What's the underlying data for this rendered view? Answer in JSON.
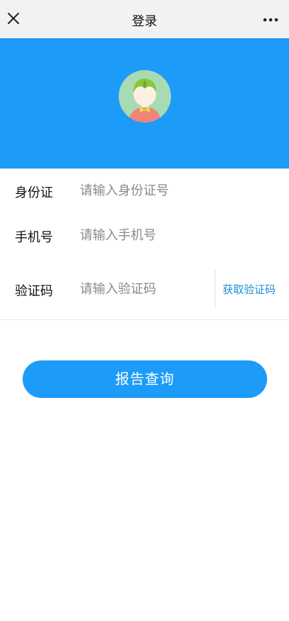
{
  "navbar": {
    "title": "登录",
    "close_icon": "close-icon",
    "more_icon": "more-horizontal-icon"
  },
  "banner": {
    "avatar_icon": "user-avatar-icon",
    "color": "#1c9bf8"
  },
  "form": {
    "id_card": {
      "label": "身份证",
      "placeholder": "请输入身份证号",
      "value": ""
    },
    "phone": {
      "label": "手机号",
      "placeholder": "请输入手机号",
      "value": ""
    },
    "code": {
      "label": "验证码",
      "placeholder": "请输入验证码",
      "value": "",
      "get_code_label": "获取验证码"
    }
  },
  "submit": {
    "label": "报告查询",
    "color": "#1c9bf8"
  }
}
